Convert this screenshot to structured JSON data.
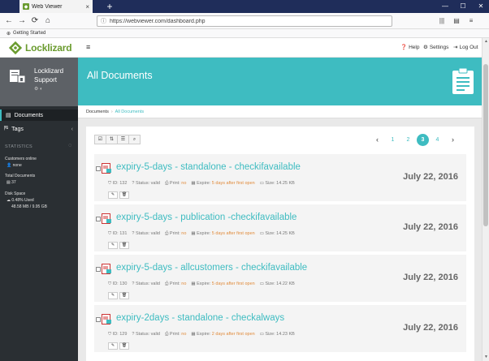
{
  "browser": {
    "tab_title": "Web Viewer",
    "url": "https://webviewer.com/dashboard.php",
    "bookmark": "Getting Started"
  },
  "app": {
    "logo_text": "Locklizard",
    "header_links": {
      "help": "Help",
      "settings": "Settings",
      "logout": "Log Out"
    }
  },
  "sidebar": {
    "profile_name": "Locklizard Support",
    "menu": [
      {
        "label": "Documents",
        "active": true
      },
      {
        "label": "Tags",
        "active": false
      }
    ],
    "stats_title": "STATISTICS",
    "customers_label": "Customers online",
    "customers_value": "none",
    "total_docs_label": "Total Documents",
    "total_docs_value": "37",
    "disk_label": "Disk Space",
    "disk_used": "0.48% Used",
    "disk_size": "48.58 MB / 9.95 GB"
  },
  "main": {
    "title": "All Documents",
    "breadcrumb": [
      "Documents",
      "All Documents"
    ],
    "pager": {
      "pages": [
        "1",
        "2",
        "3",
        "4"
      ],
      "active": "3"
    },
    "documents": [
      {
        "title": "expiry-5-days - standalone - checkifavailable",
        "date": "July 22, 2016",
        "id": "ID: 132",
        "status_label": "Status:",
        "status": "valid",
        "print_label": "Print:",
        "print": "no",
        "expire_label": "Expire:",
        "expire": "5 days after first open",
        "size": "Size: 14.25 KB"
      },
      {
        "title": "expiry-5-days - publication -checkifavailable",
        "date": "July 22, 2016",
        "id": "ID: 131",
        "status_label": "Status:",
        "status": "valid",
        "print_label": "Print:",
        "print": "no",
        "expire_label": "Expire:",
        "expire": "5 days after first open",
        "size": "Size: 14.25 KB"
      },
      {
        "title": "expiry-5-days - allcustomers - checkifavailable",
        "date": "July 22, 2016",
        "id": "ID: 130",
        "status_label": "Status:",
        "status": "valid",
        "print_label": "Print:",
        "print": "no",
        "expire_label": "Expire:",
        "expire": "5 days after first open",
        "size": "Size: 14.22 KB"
      },
      {
        "title": "expiry-2days - standalone - checkalways",
        "date": "July 22, 2016",
        "id": "ID: 129",
        "status_label": "Status:",
        "status": "valid",
        "print_label": "Print:",
        "print": "no",
        "expire_label": "Expire:",
        "expire": "2 days after first open",
        "size": "Size: 14.23 KB"
      }
    ]
  },
  "colors": {
    "accent": "#3ebcc1",
    "sidebar": "#2a2f33",
    "brand": "#6a9b2e"
  }
}
